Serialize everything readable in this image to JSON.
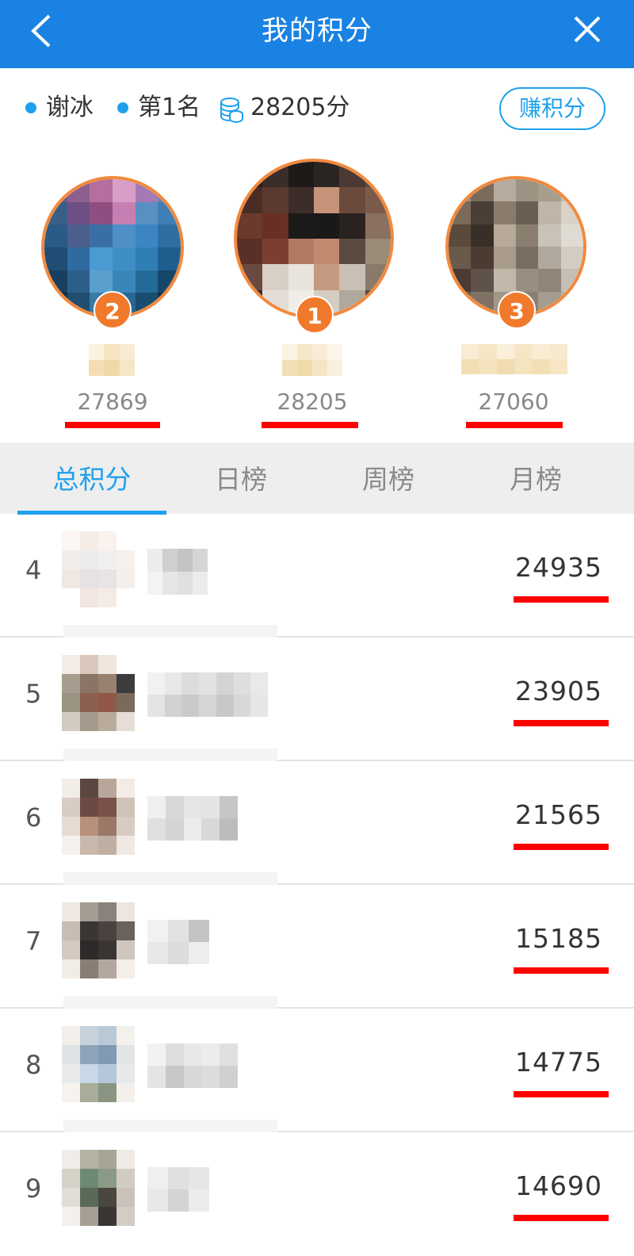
{
  "header": {
    "title": "我的积分",
    "back_icon": "chevron-left-icon",
    "close_icon": "close-icon"
  },
  "user": {
    "name": "谢冰",
    "rank_text": "第1名",
    "points_text": "28205分",
    "earn_label": "赚积分"
  },
  "podium": [
    {
      "rank": "2",
      "score": "27869"
    },
    {
      "rank": "1",
      "score": "28205"
    },
    {
      "rank": "3",
      "score": "27060"
    }
  ],
  "tabs": [
    {
      "label": "总积分",
      "active": true
    },
    {
      "label": "日榜",
      "active": false
    },
    {
      "label": "周榜",
      "active": false
    },
    {
      "label": "月榜",
      "active": false
    }
  ],
  "list": [
    {
      "rank": "4",
      "score": "24935"
    },
    {
      "rank": "5",
      "score": "23905"
    },
    {
      "rank": "6",
      "score": "21565"
    },
    {
      "rank": "7",
      "score": "15185"
    },
    {
      "rank": "8",
      "score": "14775"
    },
    {
      "rank": "9",
      "score": "14690"
    }
  ],
  "colors": {
    "header": "#1a82e2",
    "accent": "#1fa0ee",
    "badge": "#f0792b",
    "highlight": "#ff0000"
  }
}
